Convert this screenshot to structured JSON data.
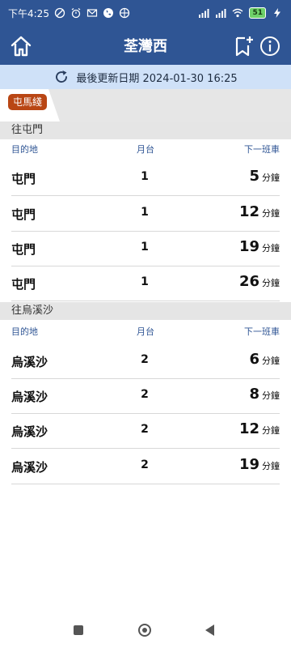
{
  "status": {
    "time": "下午4:25",
    "battery": "51"
  },
  "header": {
    "title": "荃灣西"
  },
  "update": {
    "text": "最後更新日期 2024-01-30 16:25"
  },
  "tabs": [
    {
      "label": "屯馬綫",
      "color": "#b94614"
    }
  ],
  "columns": {
    "destination": "目的地",
    "platform": "月台",
    "next": "下一班車"
  },
  "sections": [
    {
      "title": "往屯門",
      "rows": [
        {
          "dest": "屯門",
          "platform": "1",
          "minutes": "5",
          "unit": "分鐘"
        },
        {
          "dest": "屯門",
          "platform": "1",
          "minutes": "12",
          "unit": "分鐘"
        },
        {
          "dest": "屯門",
          "platform": "1",
          "minutes": "19",
          "unit": "分鐘"
        },
        {
          "dest": "屯門",
          "platform": "1",
          "minutes": "26",
          "unit": "分鐘"
        }
      ]
    },
    {
      "title": "往烏溪沙",
      "rows": [
        {
          "dest": "烏溪沙",
          "platform": "2",
          "minutes": "6",
          "unit": "分鐘"
        },
        {
          "dest": "烏溪沙",
          "platform": "2",
          "minutes": "8",
          "unit": "分鐘"
        },
        {
          "dest": "烏溪沙",
          "platform": "2",
          "minutes": "12",
          "unit": "分鐘"
        },
        {
          "dest": "烏溪沙",
          "platform": "2",
          "minutes": "19",
          "unit": "分鐘"
        }
      ]
    }
  ],
  "icons": {
    "home": "home-icon",
    "bookmark": "bookmark-add-icon",
    "info": "info-icon",
    "refresh": "refresh-icon"
  }
}
